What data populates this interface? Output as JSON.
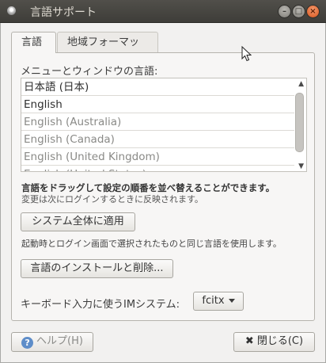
{
  "window": {
    "title": "言語サポート"
  },
  "tabs": [
    {
      "label": "言語"
    },
    {
      "label": "地域フォーマット"
    }
  ],
  "language_section": {
    "label": "メニューとウィンドウの言語:",
    "items": [
      {
        "label": "日本語 (日本)"
      },
      {
        "label": "English"
      },
      {
        "label": "English (Australia)"
      },
      {
        "label": "English (Canada)"
      },
      {
        "label": "English (United Kingdom)"
      },
      {
        "label": "English (United States)"
      }
    ],
    "hint_bold": "言語をドラッグして設定の順番を並べ替えることができます。",
    "hint_note": "変更は次にログインするときに反映されます。"
  },
  "apply_button": {
    "label": "システム全体に適用"
  },
  "apply_note": "起動時とログイン画面で選択されたものと同じ言語を使用します。",
  "install_button": {
    "label": "言語のインストールと削除..."
  },
  "input_method": {
    "label": "キーボード入力に使うIMシステム:",
    "selected": "fcitx"
  },
  "footer": {
    "help_label": "ヘルプ(H)",
    "close_label": "閉じる(C)"
  },
  "icons": {
    "app": "app-icon",
    "help": "help-icon",
    "close": "x-icon",
    "cursor": "mouse-pointer-icon"
  }
}
